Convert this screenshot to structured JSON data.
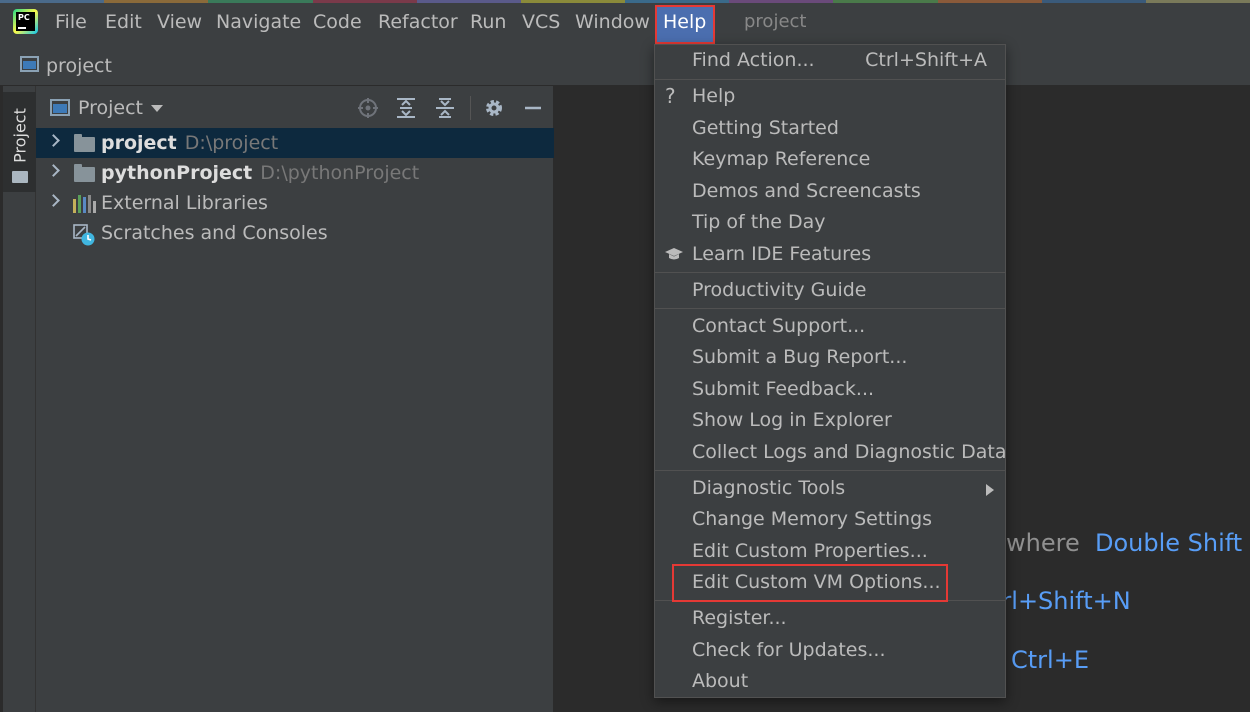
{
  "menubar": {
    "logo_text": "PC",
    "items": [
      {
        "label": "File"
      },
      {
        "label": "Edit"
      },
      {
        "label": "View"
      },
      {
        "label": "Navigate"
      },
      {
        "label": "Code"
      },
      {
        "label": "Refactor"
      },
      {
        "label": "Run"
      },
      {
        "label": "VCS"
      },
      {
        "label": "Window"
      },
      {
        "label": "Help"
      }
    ],
    "window_title": "project"
  },
  "navbar": {
    "label": "project"
  },
  "toolstrip": {
    "tab_label": "Project"
  },
  "project_panel": {
    "title": "Project",
    "tree": [
      {
        "name": "project",
        "path": "D:\\project"
      },
      {
        "name": "pythonProject",
        "path": "D:\\pythonProject"
      },
      {
        "name": "External Libraries"
      },
      {
        "name": "Scratches and Consoles"
      }
    ]
  },
  "help_menu": {
    "items": [
      {
        "label": "Find Action...",
        "shortcut": "Ctrl+Shift+A"
      },
      {
        "label": "Help",
        "icon": "question-icon"
      },
      {
        "label": "Getting Started"
      },
      {
        "label": "Keymap Reference"
      },
      {
        "label": "Demos and Screencasts"
      },
      {
        "label": "Tip of the Day"
      },
      {
        "label": "Learn IDE Features",
        "icon": "graduation-cap-icon"
      },
      {
        "label": "Productivity Guide"
      },
      {
        "label": "Contact Support..."
      },
      {
        "label": "Submit a Bug Report..."
      },
      {
        "label": "Submit Feedback..."
      },
      {
        "label": "Show Log in Explorer"
      },
      {
        "label": "Collect Logs and Diagnostic Data"
      },
      {
        "label": "Diagnostic Tools"
      },
      {
        "label": "Change Memory Settings"
      },
      {
        "label": "Edit Custom Properties..."
      },
      {
        "label": "Edit Custom VM Options..."
      },
      {
        "label": "Register..."
      },
      {
        "label": "Check for Updates..."
      },
      {
        "label": "About"
      }
    ]
  },
  "editor_hints": [
    {
      "text": "where",
      "key": "Double Shift"
    },
    {
      "text": "",
      "key": "trl+Shift+N"
    },
    {
      "text": "",
      "key": "Ctrl+E"
    }
  ],
  "colors": {
    "menu_bg": "#3c3f41",
    "editor_bg": "#2b2b2b",
    "selection": "#4b6eaf",
    "tree_selection": "#0d293e",
    "key_hint": "#589df6",
    "highlight_box": "#e53935"
  }
}
